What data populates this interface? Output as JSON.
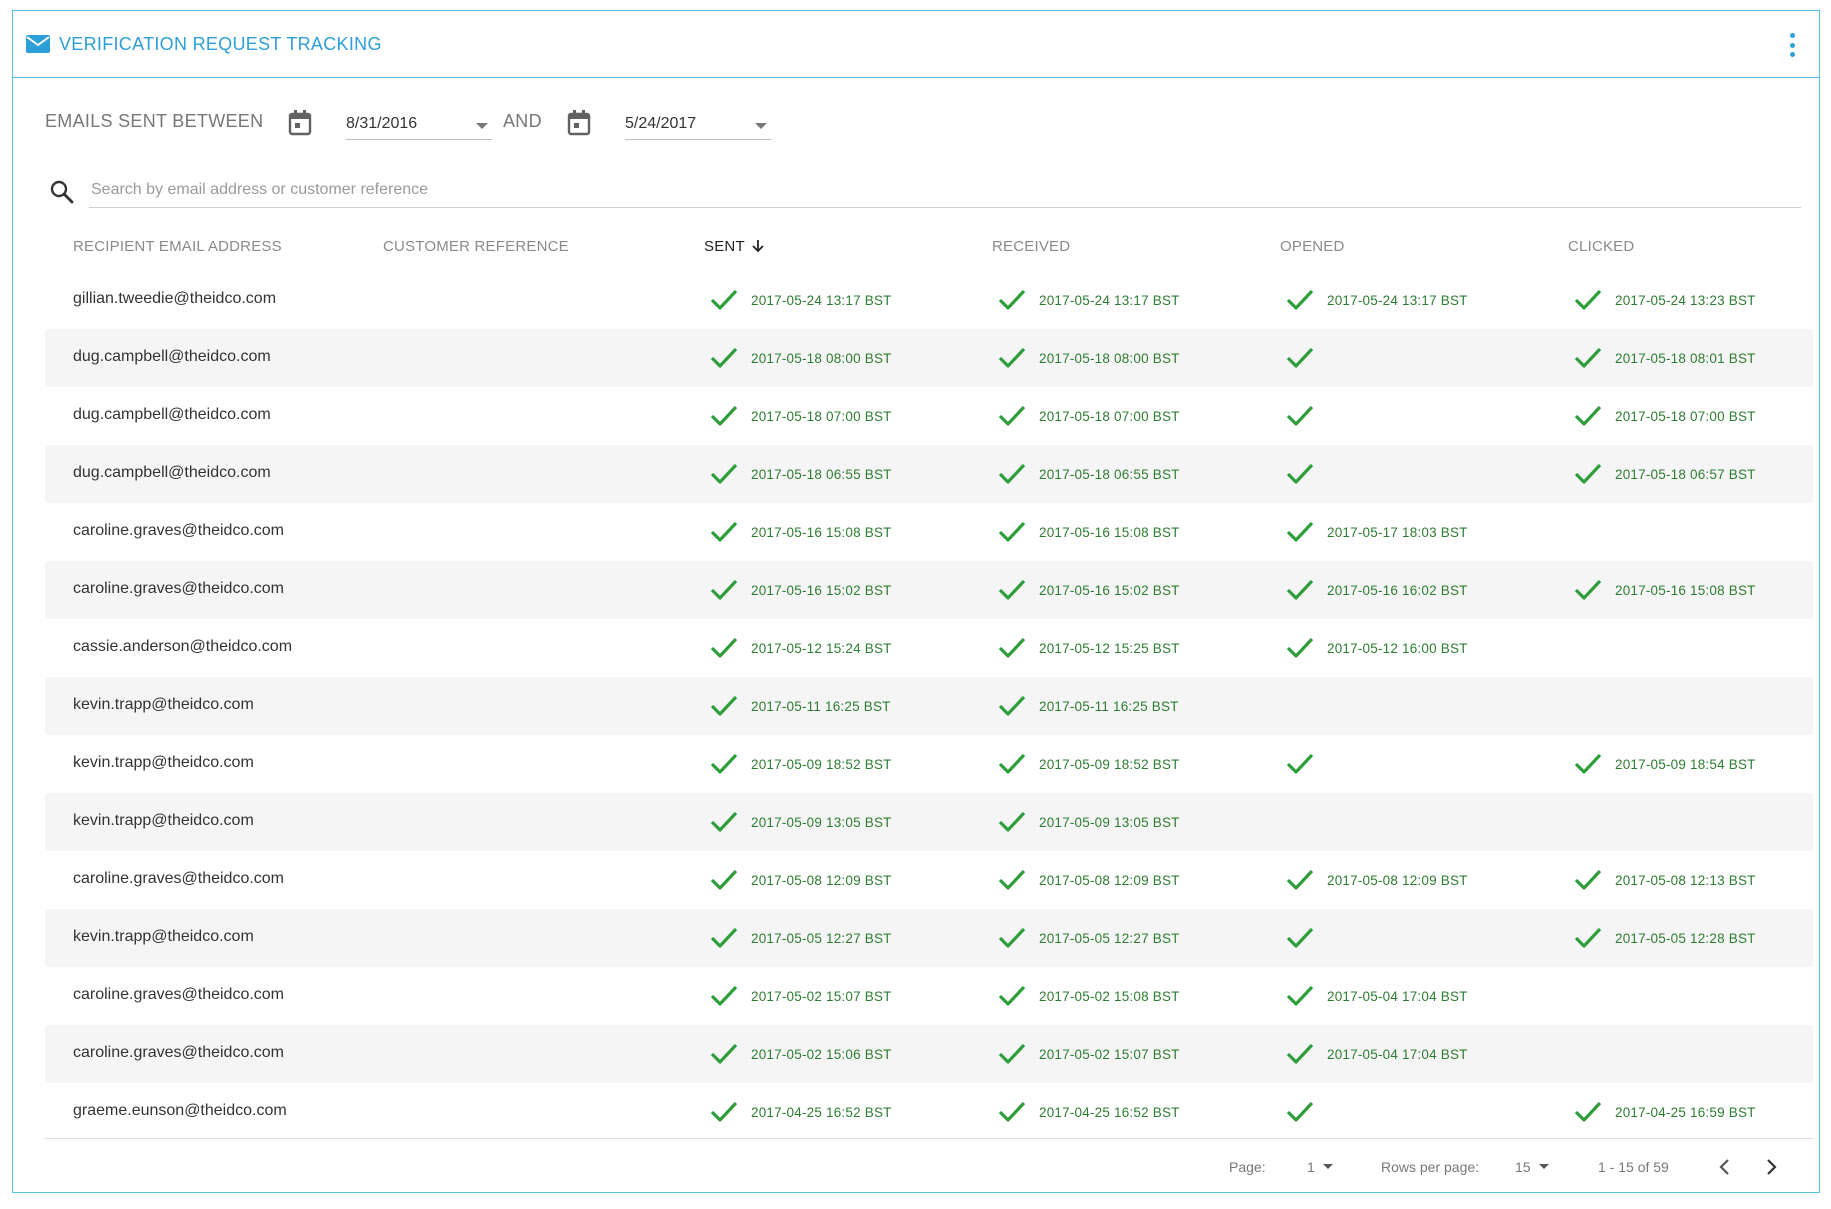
{
  "header": {
    "title": "VERIFICATION REQUEST TRACKING",
    "title_icon": "mail-icon",
    "menu_icon": "more-vert-icon",
    "accent_color": "#2d9fd8"
  },
  "filter": {
    "label": "EMAILS SENT BETWEEN",
    "from_date": "8/31/2016",
    "and_label": "AND",
    "to_date": "5/24/2017"
  },
  "search": {
    "placeholder": "Search by email address or customer reference",
    "value": ""
  },
  "columns": {
    "recipient": "RECIPIENT EMAIL ADDRESS",
    "customer_ref": "CUSTOMER REFERENCE",
    "sent": "SENT",
    "received": "RECEIVED",
    "opened": "OPENED",
    "clicked": "CLICKED"
  },
  "sort": {
    "column": "sent",
    "direction": "desc"
  },
  "rows": [
    {
      "email": "gillian.tweedie@theidco.com",
      "ref": "",
      "sent": "2017-05-24 13:17 BST",
      "received": "2017-05-24 13:17 BST",
      "opened": "2017-05-24 13:17 BST",
      "opened_ok": true,
      "clicked": "2017-05-24 13:23 BST",
      "clicked_ok": true
    },
    {
      "email": "dug.campbell@theidco.com",
      "ref": "",
      "sent": "2017-05-18 08:00 BST",
      "received": "2017-05-18 08:00 BST",
      "opened": "",
      "opened_ok": true,
      "clicked": "2017-05-18 08:01 BST",
      "clicked_ok": true
    },
    {
      "email": "dug.campbell@theidco.com",
      "ref": "",
      "sent": "2017-05-18 07:00 BST",
      "received": "2017-05-18 07:00 BST",
      "opened": "",
      "opened_ok": true,
      "clicked": "2017-05-18 07:00 BST",
      "clicked_ok": true
    },
    {
      "email": "dug.campbell@theidco.com",
      "ref": "",
      "sent": "2017-05-18 06:55 BST",
      "received": "2017-05-18 06:55 BST",
      "opened": "",
      "opened_ok": true,
      "clicked": "2017-05-18 06:57 BST",
      "clicked_ok": true
    },
    {
      "email": "caroline.graves@theidco.com",
      "ref": "",
      "sent": "2017-05-16 15:08 BST",
      "received": "2017-05-16 15:08 BST",
      "opened": "2017-05-17 18:03 BST",
      "opened_ok": true,
      "clicked": "",
      "clicked_ok": false
    },
    {
      "email": "caroline.graves@theidco.com",
      "ref": "",
      "sent": "2017-05-16 15:02 BST",
      "received": "2017-05-16 15:02 BST",
      "opened": "2017-05-16 16:02 BST",
      "opened_ok": true,
      "clicked": "2017-05-16 15:08 BST",
      "clicked_ok": true
    },
    {
      "email": "cassie.anderson@theidco.com",
      "ref": "",
      "sent": "2017-05-12 15:24 BST",
      "received": "2017-05-12 15:25 BST",
      "opened": "2017-05-12 16:00 BST",
      "opened_ok": true,
      "clicked": "",
      "clicked_ok": false
    },
    {
      "email": "kevin.trapp@theidco.com",
      "ref": "",
      "sent": "2017-05-11 16:25 BST",
      "received": "2017-05-11 16:25 BST",
      "opened": "",
      "opened_ok": false,
      "clicked": "",
      "clicked_ok": false
    },
    {
      "email": "kevin.trapp@theidco.com",
      "ref": "",
      "sent": "2017-05-09 18:52 BST",
      "received": "2017-05-09 18:52 BST",
      "opened": "",
      "opened_ok": true,
      "clicked": "2017-05-09 18:54 BST",
      "clicked_ok": true
    },
    {
      "email": "kevin.trapp@theidco.com",
      "ref": "",
      "sent": "2017-05-09 13:05 BST",
      "received": "2017-05-09 13:05 BST",
      "opened": "",
      "opened_ok": false,
      "clicked": "",
      "clicked_ok": false
    },
    {
      "email": "caroline.graves@theidco.com",
      "ref": "",
      "sent": "2017-05-08 12:09 BST",
      "received": "2017-05-08 12:09 BST",
      "opened": "2017-05-08 12:09 BST",
      "opened_ok": true,
      "clicked": "2017-05-08 12:13 BST",
      "clicked_ok": true
    },
    {
      "email": "kevin.trapp@theidco.com",
      "ref": "",
      "sent": "2017-05-05 12:27 BST",
      "received": "2017-05-05 12:27 BST",
      "opened": "",
      "opened_ok": true,
      "clicked": "2017-05-05 12:28 BST",
      "clicked_ok": true
    },
    {
      "email": "caroline.graves@theidco.com",
      "ref": "",
      "sent": "2017-05-02 15:07 BST",
      "received": "2017-05-02 15:08 BST",
      "opened": "2017-05-04 17:04 BST",
      "opened_ok": true,
      "clicked": "",
      "clicked_ok": false
    },
    {
      "email": "caroline.graves@theidco.com",
      "ref": "",
      "sent": "2017-05-02 15:06 BST",
      "received": "2017-05-02 15:07 BST",
      "opened": "2017-05-04 17:04 BST",
      "opened_ok": true,
      "clicked": "",
      "clicked_ok": false
    },
    {
      "email": "graeme.eunson@theidco.com",
      "ref": "",
      "sent": "2017-04-25 16:52 BST",
      "received": "2017-04-25 16:52 BST",
      "opened": "",
      "opened_ok": true,
      "clicked": "2017-04-25 16:59 BST",
      "clicked_ok": true
    }
  ],
  "status_color": "#2e9e3a",
  "pagination": {
    "page_label": "Page:",
    "page_value": "1",
    "rows_label": "Rows per page:",
    "rows_value": "15",
    "range_text": "1 - 15 of 59",
    "prev_icon": "chevron-left-icon",
    "next_icon": "chevron-right-icon"
  }
}
